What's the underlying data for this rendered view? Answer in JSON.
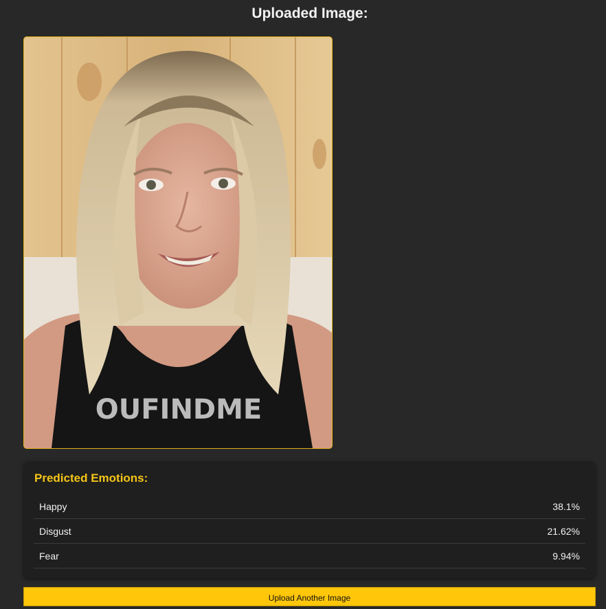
{
  "page": {
    "heading": "Uploaded Image:"
  },
  "photo": {
    "description_icon": "portrait-photo",
    "shirt_text": "OUFINDME"
  },
  "results": {
    "title": "Predicted Emotions:",
    "emotions": [
      {
        "label": "Happy",
        "value": "38.1%"
      },
      {
        "label": "Disgust",
        "value": "21.62%"
      },
      {
        "label": "Fear",
        "value": "9.94%"
      }
    ]
  },
  "actions": {
    "upload_label": "Upload Another Image"
  },
  "colors": {
    "accent": "#f5c518",
    "button": "#ffc60a",
    "background": "#282828",
    "card": "#1f1f1f"
  }
}
